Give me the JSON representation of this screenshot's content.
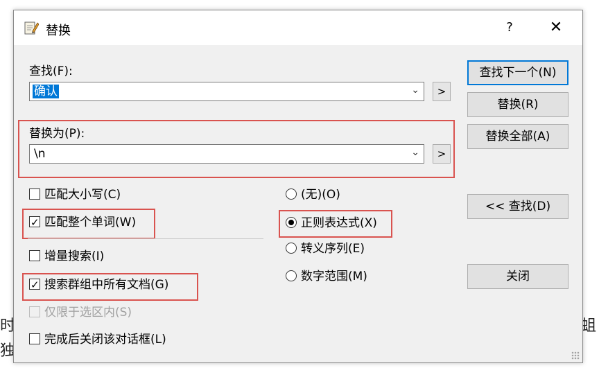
{
  "background": {
    "left_chars": [
      "时",
      "独"
    ],
    "right_chars": [
      "蛆"
    ]
  },
  "window": {
    "title": "替换",
    "help": "?",
    "close": "✕"
  },
  "find": {
    "label": "查找(F):",
    "value": "确认"
  },
  "replace": {
    "label": "替换为(P):",
    "value": "\\n"
  },
  "arrow_button": ">",
  "buttons": {
    "find_next": "查找下一个(N)",
    "replace": "替换(R)",
    "replace_all": "替换全部(A)",
    "find_less": "<< 查找(D)",
    "close": "关闭"
  },
  "checkboxes": [
    {
      "label": "匹配大小写(C)",
      "checked": false
    },
    {
      "label": "匹配整个单词(W)",
      "checked": true
    },
    {
      "label": "增量搜索(I)",
      "checked": false
    },
    {
      "label": "搜索群组中所有文档(G)",
      "checked": true
    },
    {
      "label": "仅限于选区内(S)",
      "checked": false,
      "disabled": true
    },
    {
      "label": "完成后关闭该对话框(L)",
      "checked": false
    }
  ],
  "search_mode": {
    "options": [
      "(无)(O)",
      "正则表达式(X)",
      "转义序列(E)",
      "数字范围(M)"
    ],
    "selected": "正则表达式(X)"
  },
  "highlight_color": "#d9534f",
  "accent_color": "#0078d7"
}
